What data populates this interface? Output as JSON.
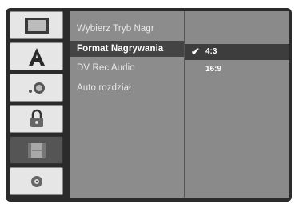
{
  "menu": {
    "items": [
      {
        "label": "Wybierz Tryb Nagr",
        "selected": false
      },
      {
        "label": "Format Nagrywania",
        "selected": true
      },
      {
        "label": "DV Rec Audio",
        "selected": false
      },
      {
        "label": "Auto rozdział",
        "selected": false
      }
    ]
  },
  "options": {
    "items": [
      {
        "label": "4:3",
        "checked": true,
        "highlighted": true,
        "check_mark": "✔"
      },
      {
        "label": "16:9",
        "checked": false,
        "highlighted": false
      }
    ]
  },
  "sidebar": {
    "icons": [
      {
        "name": "tv-screen-icon"
      },
      {
        "name": "language-a-icon"
      },
      {
        "name": "audio-icon"
      },
      {
        "name": "lock-icon"
      },
      {
        "name": "recording-icon",
        "active": true
      },
      {
        "name": "disc-icon"
      }
    ]
  }
}
